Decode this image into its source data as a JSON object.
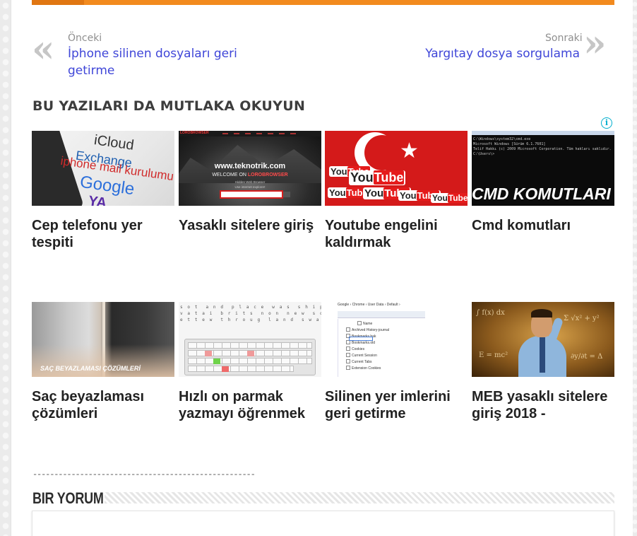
{
  "post_nav": {
    "prev_label": "Önceki",
    "prev_title": "İphone silinen dosyaları geri getirme",
    "next_label": "Sonraki",
    "next_title": "Yargıtay dosya sorgulama",
    "prev_icon": "double-chevron-left-icon",
    "next_icon": "double-chevron-right-icon"
  },
  "related": {
    "heading": "BU YAZILARI DA MUTLAKA OKUYUN",
    "ad_icon": "info-icon",
    "ad_icon_glyph": "i",
    "items": [
      {
        "title": "Cep telefonu yer tespiti"
      },
      {
        "title": "Yasaklı sitelere giriş"
      },
      {
        "title": "Youtube engelini kaldırmak"
      },
      {
        "title": "Cmd komutları"
      },
      {
        "title": "Saç beyazlaması çözümleri"
      },
      {
        "title": "Hızlı on parmak yazmayı öğrenmek"
      },
      {
        "title": "Silinen yer imlerini geri getirme"
      },
      {
        "title": "MEB yasaklı sitelere giriş 2018 -"
      }
    ]
  },
  "thumbs": {
    "icloud": {
      "line1": "iCloud",
      "line2": "Exchange",
      "line3": "iphone mail kurulumu",
      "line4": "Google",
      "line5": "YA"
    },
    "browser": {
      "brand": "LOROBROWSER",
      "site": "www.teknotrik.com",
      "welcome_prefix": "WELCOME ON ",
      "welcome_brand": "LOROBROWSER",
      "sub1": "Hidden Web Browser",
      "sub2": "Use internet explorer!"
    },
    "youtube": {
      "logo_you": "You",
      "logo_tube": "Tube"
    },
    "cmd": {
      "line1": "C:\\Windows\\system32\\cmd.exe",
      "line2": "Microsoft Windows [Sürüm 6.1.7601]",
      "line3": "Telif Hakkı (c) 2009 Microsoft Corporation. Tüm hakları saklıdır.",
      "line4": "C:\\Users\\>",
      "label": "CMD KOMUTLARI"
    },
    "hair": {
      "caption": "SAÇ BEYAZLAMASI ÇÖZÜMLERİ"
    },
    "typing": {
      "line1": "s o t  a n d  p l a c e  w a s  s h i p s  a n",
      "line2": "v a t a i  b r i t s  n o n  n e w  s o l a r",
      "line3": "e t t e w  t h r o u g  l a n d  s w a r n"
    },
    "chrome": {
      "crumb": "Google › Chrome › User Data › Default ›",
      "items": [
        "Name",
        "Archived History-journal",
        "Bookmarks.bak",
        "Bookmarks.old",
        "Cookies",
        "Current Session",
        "Current Tabs",
        "Extension Cookies"
      ]
    },
    "meb": {
      "f1": "∫ f(x) dx",
      "f2": "Σ √x² + y²",
      "f3": "E = mc²",
      "f4": "∂y/∂t = Δ"
    }
  },
  "divider": "----------------------------------------------------",
  "comments": {
    "heading": "BIR YORUM"
  },
  "colors": {
    "accent": "#f28a1e",
    "link": "#3f46d8",
    "ad_info": "#00aecd"
  }
}
